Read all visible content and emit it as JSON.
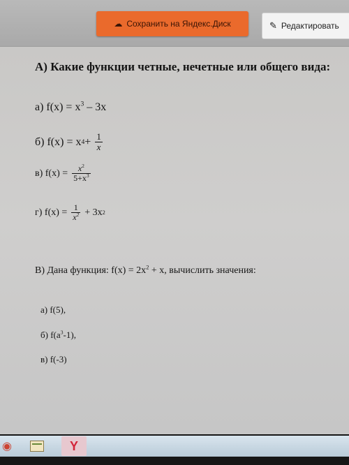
{
  "toolbar": {
    "save_label": "Сохранить на Яндекс.Диск",
    "edit_label": "Редактировать"
  },
  "document": {
    "section_a": {
      "heading": "А) Какие функции четные, нечетные или общего вида:",
      "item_a": {
        "prefix": "а) f(x) = x",
        "exp": "3",
        "suffix": " – 3x"
      },
      "item_b": {
        "prefix": "б) f(x) = x",
        "exp": "4",
        "plus": " +",
        "frac_num": "1",
        "frac_den": "x"
      },
      "item_v": {
        "prefix": "в) f(x) =",
        "frac_num_base": "x",
        "frac_num_exp": "2",
        "frac_den_base": "5+x",
        "frac_den_exp": "3"
      },
      "item_g": {
        "prefix": "г) f(x) =",
        "frac_num": "1",
        "frac_den_base": "x",
        "frac_den_exp": "2",
        "suffix_base": "+ 3x",
        "suffix_exp": "2"
      }
    },
    "section_b": {
      "heading_pre": "В) Дана функция: f(x) = 2x",
      "heading_exp": "2",
      "heading_post": " + x, вычислить значения:",
      "item_1": "а) f(5),",
      "item_2_pre": "б) f(a",
      "item_2_exp": "3",
      "item_2_post": "-1),",
      "item_3": "в) f(-3)"
    }
  },
  "taskbar": {
    "app2_label": "Y"
  },
  "colors": {
    "save_button": "#ea6a2c",
    "page_background": "#cbcac8",
    "taskbar": "#c7d6e2"
  }
}
